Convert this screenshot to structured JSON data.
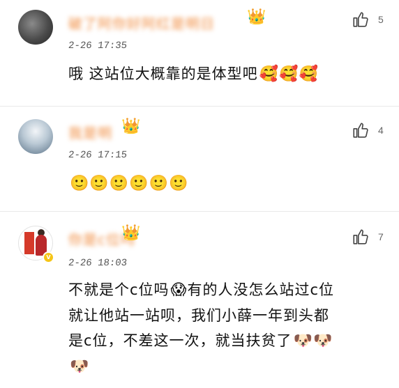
{
  "comments": [
    {
      "username": "破了阿你好阿红是明日",
      "crown": "👑",
      "time": "2-26 17:35",
      "like_count": "5",
      "text": "哦 这站位大概靠的是体型吧",
      "emoji": "🥰🥰🥰"
    },
    {
      "username": "我是明",
      "crown": "👑",
      "time": "2-26 17:15",
      "like_count": "4",
      "text": "",
      "emoji": "🙂🙂🙂🙂🙂🙂"
    },
    {
      "username": "你是c位吗",
      "crown": "👑",
      "time": "2-26 18:03",
      "like_count": "7",
      "text_line1": "不就是个c位吗",
      "emoji_line1": "😱",
      "text_line1b": "有的人没怎么站过c位",
      "text_line2": "就让他站一站呗，我们小薛一年到头都",
      "text_line3": "是c位，不差这一次，就当扶贫了",
      "emoji_line3": "🐶🐶",
      "emoji_line4": "🐶"
    }
  ],
  "icons": {
    "like": "thumbs-up-icon",
    "crown": "crown-icon",
    "verified": "verified-badge-icon"
  },
  "colors": {
    "username": "#f08a3c",
    "timestamp": "#555555",
    "like_icon": "#444444",
    "verified": "#f5c518"
  }
}
